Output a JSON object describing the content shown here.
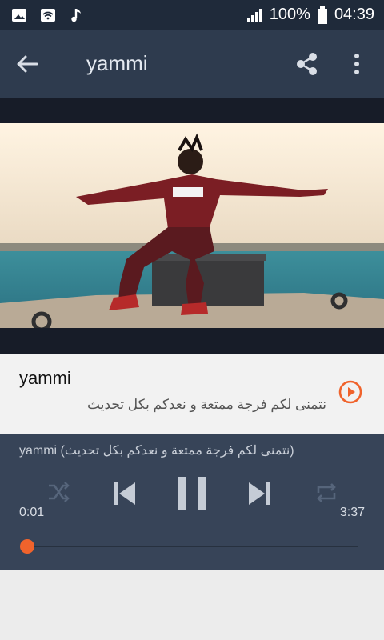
{
  "status_bar": {
    "battery": "100%",
    "time": "04:39",
    "icons": [
      "image-icon",
      "wifi-icon",
      "music-note-icon",
      "signal-icon",
      "battery-icon"
    ]
  },
  "app_bar": {
    "title": "yammi",
    "icons": [
      "back-arrow-icon",
      "share-icon",
      "more-vert-icon"
    ]
  },
  "track": {
    "title": "yammi",
    "subtitle": "نتمنى لكم فرجة ممتعة و نعدكم بكل تحديث"
  },
  "player": {
    "now_playing": "yammi (نتمنى لكم فرجة ممتعة و نعدكم بكل تحديث)",
    "elapsed": "0:01",
    "duration": "3:37",
    "progress": 0.005,
    "icons": [
      "shuffle-icon",
      "previous-icon",
      "pause-icon",
      "next-icon",
      "repeat-icon"
    ]
  },
  "colors": {
    "status_bar": "#1f2a3a",
    "app_bar": "#2e3b4e",
    "player": "#374458",
    "accent": "#f0632c"
  }
}
